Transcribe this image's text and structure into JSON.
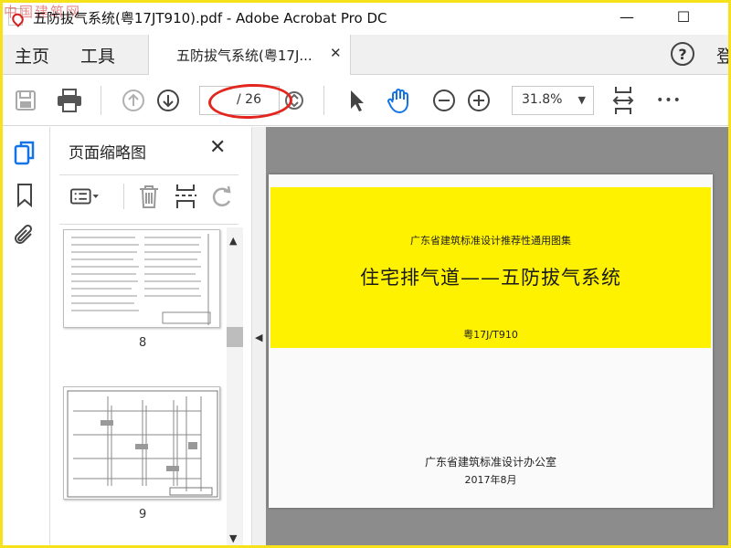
{
  "window": {
    "watermark": "中国建筑网",
    "title": "五防拔气系统(粤17JT910).pdf - Adobe Acrobat Pro DC",
    "minimize": "—",
    "maximize": "☐"
  },
  "menu": {
    "home": "主页",
    "tools": "工具",
    "doc_tab": "五防拔气系统(粤17J...",
    "doc_tab_close": "✕",
    "help": "?",
    "login": "登"
  },
  "toolbar": {
    "page_total": "/ 26",
    "zoom": "31.8%",
    "zoom_arrow": "▼",
    "more": "•••"
  },
  "panel": {
    "title": "页面缩略图",
    "close": "✕",
    "thumbnails": [
      {
        "number": "8"
      },
      {
        "number": "9"
      }
    ],
    "scroll_up": "▲",
    "scroll_down": "▼",
    "collapse": "◀"
  },
  "document": {
    "series": "广东省建筑标准设计推荐性通用图集",
    "heading": "住宅排气道——五防拔气系统",
    "code": "粤17J/T910",
    "publisher": "广东省建筑标准设计办公室",
    "date": "2017年8月"
  },
  "colors": {
    "frame": "#f5e21a",
    "cover_yellow": "#fff200",
    "accent_blue": "#1473e6",
    "annotation_red": "#e2261f"
  },
  "icons": [
    "app-icon",
    "save-icon",
    "print-icon",
    "prev-page-icon",
    "next-page-icon",
    "scroll-page-icon",
    "select-arrow-icon",
    "hand-icon",
    "zoom-out-icon",
    "zoom-in-icon",
    "fit-page-icon",
    "more-icon",
    "pages-icon",
    "bookmark-icon",
    "paperclip-icon",
    "options-icon",
    "delete-icon",
    "insert-page-icon",
    "rotate-icon"
  ]
}
